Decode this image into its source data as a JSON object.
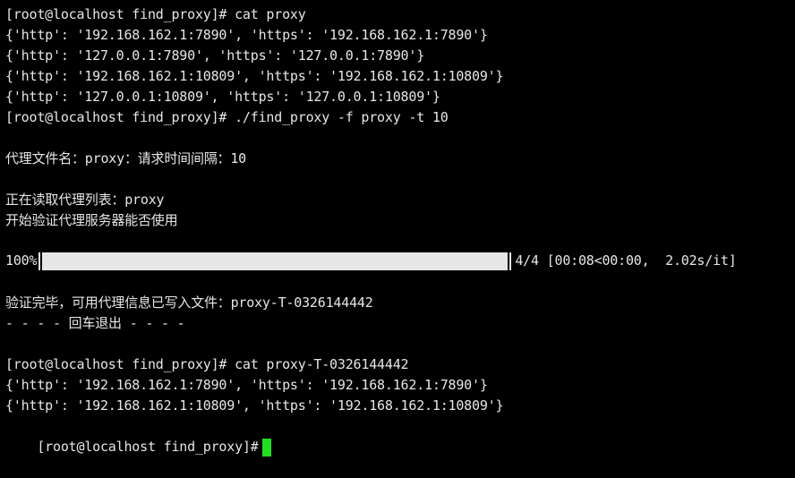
{
  "terminal": {
    "lines": [
      "[root@localhost find_proxy]# cat proxy",
      "{'http': '192.168.162.1:7890', 'https': '192.168.162.1:7890'}",
      "{'http': '127.0.0.1:7890', 'https': '127.0.0.1:7890'}",
      "{'http': '192.168.162.1:10809', 'https': '192.168.162.1:10809'}",
      "{'http': '127.0.0.1:10809', 'https': '127.0.0.1:10809'}",
      "[root@localhost find_proxy]# ./find_proxy -f proxy -t 10",
      "代理文件名：proxy：请求时间间隔：10",
      "正在读取代理列表：proxy",
      "开始验证代理服务器能否使用",
      "验证完毕，可用代理信息已写入文件：proxy-T-0326144442",
      "- - - - 回车退出 - - - -",
      "[root@localhost find_proxy]# cat proxy-T-0326144442",
      "{'http': '192.168.162.1:7890', 'https': '192.168.162.1:7890'}",
      "{'http': '192.168.162.1:10809', 'https': '192.168.162.1:10809'}"
    ],
    "progress": {
      "percent_label": "100%",
      "fraction": 1.0,
      "stats": "4/4 [00:08<00:00,  2.02s/it]"
    },
    "prompt": "[root@localhost find_proxy]#",
    "cursor_color": "#22dd22"
  }
}
